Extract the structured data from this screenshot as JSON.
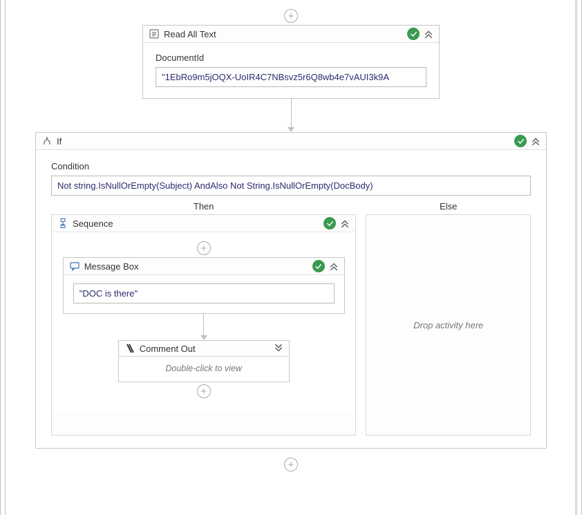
{
  "canvas": {
    "readAllText": {
      "title": "Read All Text",
      "fieldLabel": "DocumentId",
      "value": "\"1EbRo9m5jOQX-UoIR4C7NBsvz5r6Q8wb4e7vAUI3k9A"
    },
    "if": {
      "title": "If",
      "conditionLabel": "Condition",
      "conditionValue": "Not string.IsNullOrEmpty(Subject) AndAlso Not String.IsNullOrEmpty(DocBody)",
      "thenLabel": "Then",
      "elseLabel": "Else",
      "elsePlaceholder": "Drop activity here",
      "sequence": {
        "title": "Sequence",
        "messageBox": {
          "title": "Message Box",
          "value": "\"DOC is there\""
        },
        "commentOut": {
          "title": "Comment Out",
          "hint": "Double-click to view"
        }
      }
    }
  }
}
